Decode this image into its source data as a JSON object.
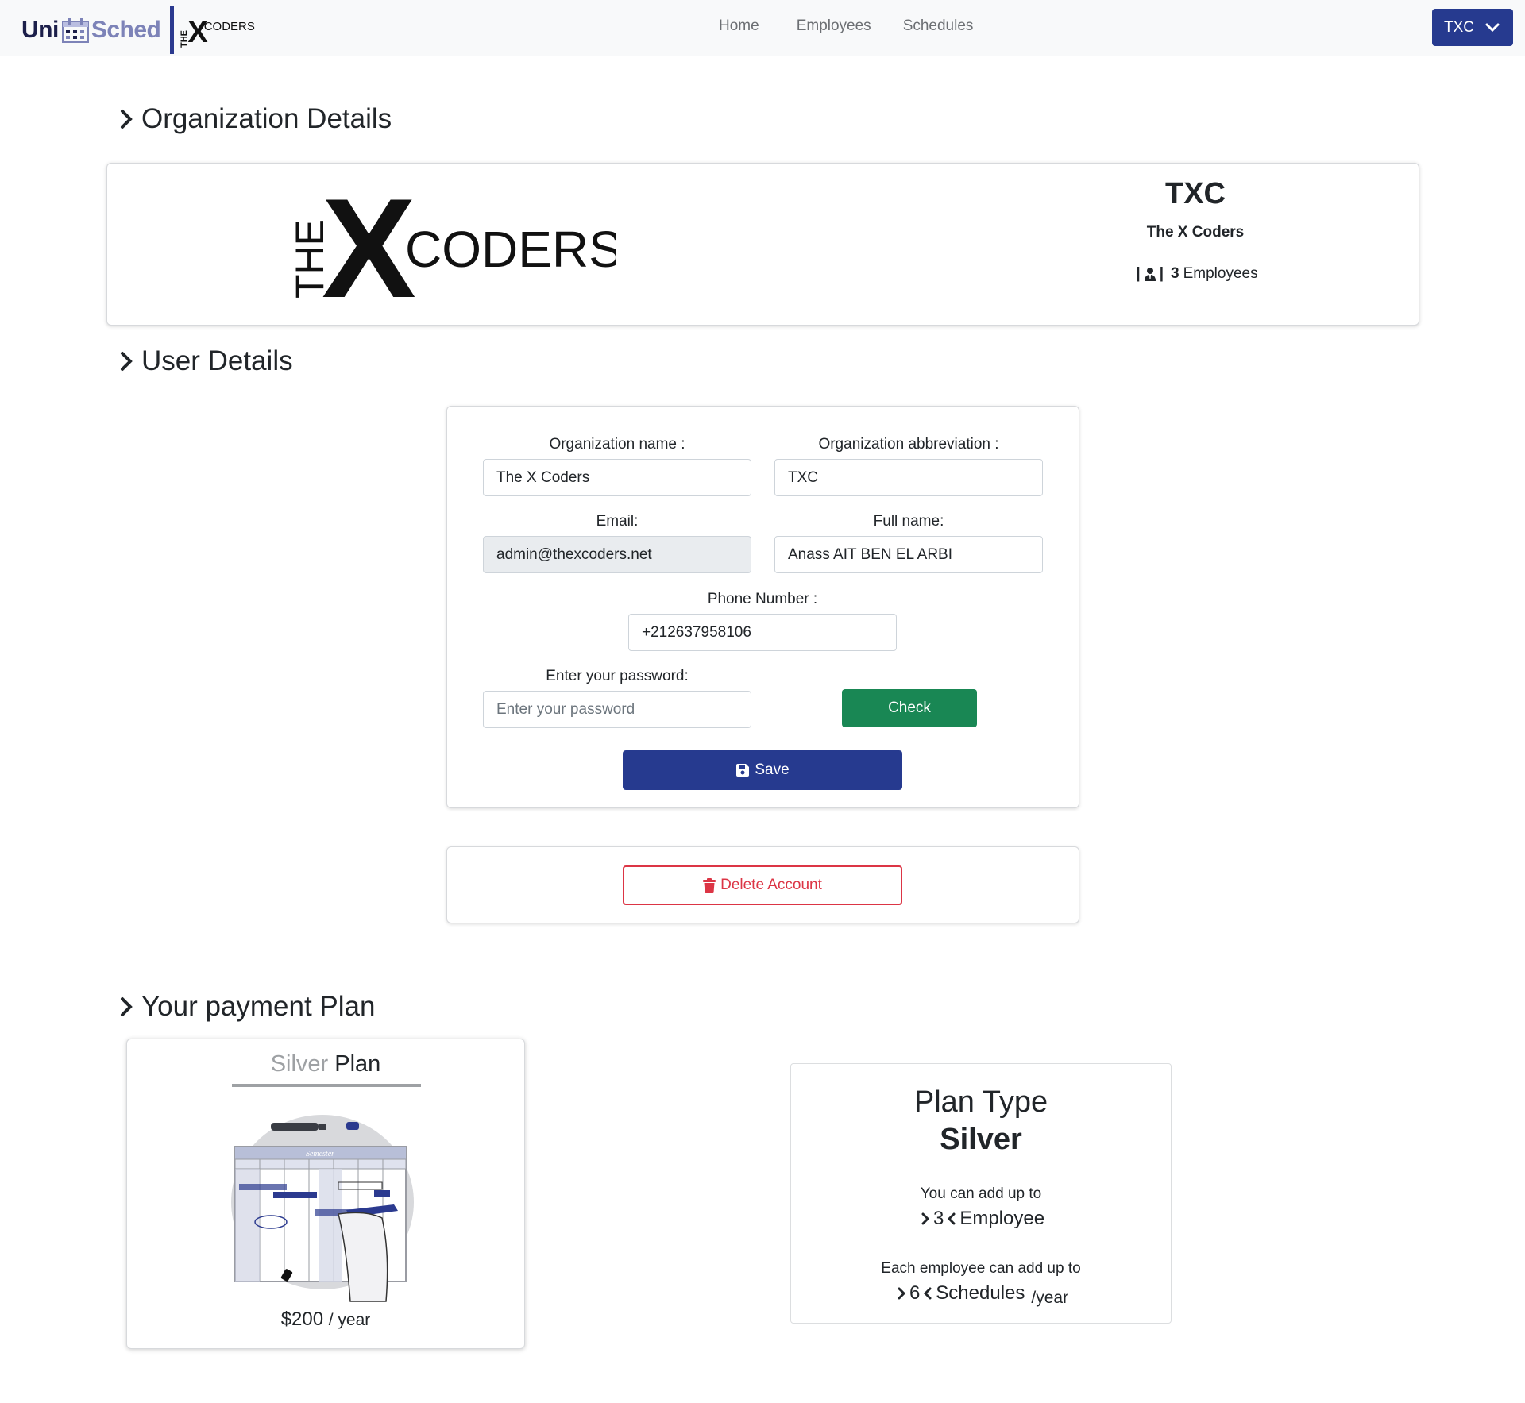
{
  "brand": {
    "uni": "Uni",
    "sched": "Sched",
    "partner_the": "THE",
    "partner_x": "X",
    "partner_coders": "CODERS"
  },
  "nav": {
    "home": "Home",
    "employees": "Employees",
    "schedules": "Schedules"
  },
  "user_menu": {
    "label": "TXC"
  },
  "sections": {
    "organization": "Organization Details",
    "user": "User Details",
    "plan": "Your payment Plan"
  },
  "organization": {
    "logo": {
      "the": "THE",
      "x": "X",
      "coders": "CODERS"
    },
    "abbreviation": "TXC",
    "name": "The X Coders",
    "employee_count": "3",
    "employee_label": "Employees",
    "pipe": "|"
  },
  "form": {
    "org_name": {
      "label": "Organization name :",
      "value": "The X Coders"
    },
    "org_abbr": {
      "label": "Organization abbreviation :",
      "value": "TXC"
    },
    "email": {
      "label": "Email:",
      "value": "admin@thexcoders.net"
    },
    "full_name": {
      "label": "Full name:",
      "value": "Anass AIT BEN EL ARBI"
    },
    "phone": {
      "label": "Phone Number :",
      "value": "+212637958106"
    },
    "password": {
      "label": "Enter your password:",
      "placeholder": "Enter your password"
    },
    "check_label": "Check",
    "save_label": "Save"
  },
  "delete": {
    "label": "Delete Account"
  },
  "plan_card": {
    "tier": "Silver",
    "plan_word": "Plan",
    "price": "$200",
    "period": "/ year",
    "image": {
      "semester": "Semester"
    }
  },
  "plan_type": {
    "heading": "Plan Type",
    "tier": "Silver",
    "employee_intro": "You can add up to",
    "employee_limit": "3",
    "employee_unit": "Employee",
    "schedule_intro": "Each employee can add up to",
    "schedule_limit": "6",
    "schedule_unit": "Schedules",
    "schedule_period": "/year"
  },
  "colors": {
    "primary": "#263a8f",
    "success": "#198754",
    "danger": "#dc3545",
    "navbar_bg": "#f8f9fa",
    "muted": "#9ea1a4"
  },
  "icons": {
    "chevron": "chevron-right-icon",
    "dropdown": "chevron-down-icon",
    "user": "user-tie-icon",
    "save": "floppy-disk-icon",
    "delete": "trash-icon"
  }
}
